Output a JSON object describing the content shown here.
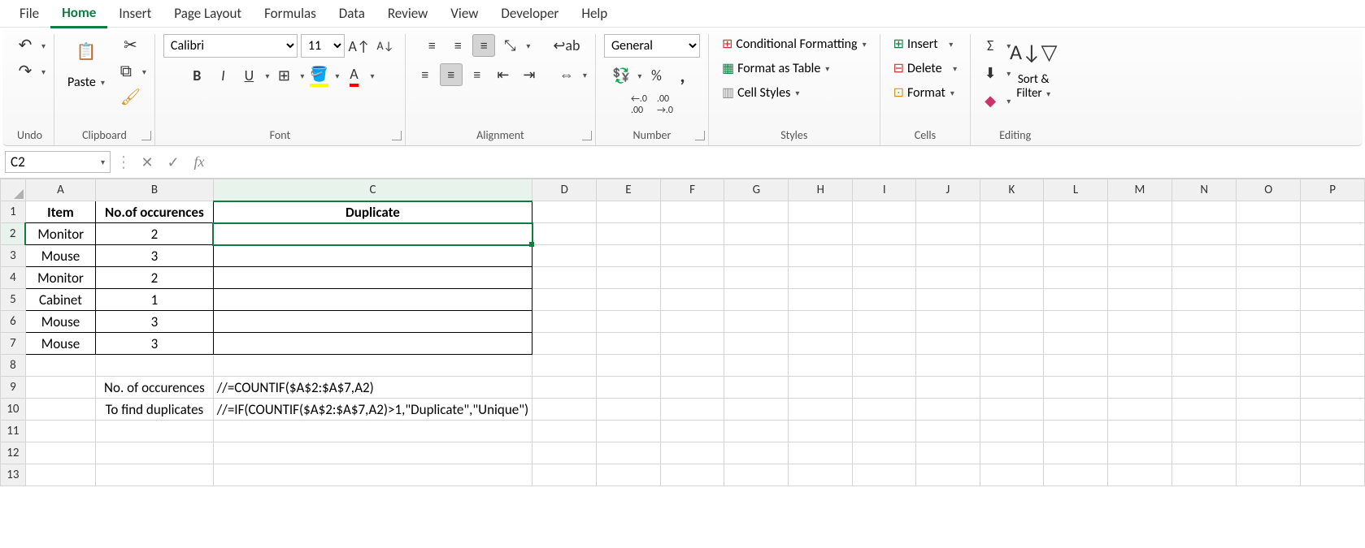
{
  "menubar": [
    "File",
    "Home",
    "Insert",
    "Page Layout",
    "Formulas",
    "Data",
    "Review",
    "View",
    "Developer",
    "Help"
  ],
  "active_tab": "Home",
  "ribbon": {
    "undo_label": "Undo",
    "clipboard_label": "Clipboard",
    "paste_label": "Paste",
    "font_label": "Font",
    "font_name": "Calibri",
    "font_size": "11",
    "alignment_label": "Alignment",
    "number_label": "Number",
    "number_format": "General",
    "styles_label": "Styles",
    "cond_fmt": "Conditional Formatting",
    "fmt_table": "Format as Table",
    "cell_styles": "Cell Styles",
    "cells_label": "Cells",
    "insert": "Insert",
    "delete": "Delete",
    "format": "Format",
    "editing_label": "Editing",
    "sort_filter1": "Sort &",
    "sort_filter2": "Filter"
  },
  "namebox": "C2",
  "formula": "",
  "columns": [
    "A",
    "B",
    "C",
    "D",
    "E",
    "F",
    "G",
    "H",
    "I",
    "J",
    "K",
    "L",
    "M",
    "N",
    "O",
    "P"
  ],
  "selected": {
    "col": "C",
    "row": 2
  },
  "chart_data": {
    "type": "table",
    "headers": {
      "A": "Item",
      "B": "No.of occurences",
      "C": "Duplicate"
    },
    "rows": [
      {
        "A": "Monitor",
        "B": "2",
        "C": ""
      },
      {
        "A": "Mouse",
        "B": "3",
        "C": ""
      },
      {
        "A": "Monitor",
        "B": "2",
        "C": ""
      },
      {
        "A": "Cabinet",
        "B": "1",
        "C": ""
      },
      {
        "A": "Mouse",
        "B": "3",
        "C": ""
      },
      {
        "A": "Mouse",
        "B": "3",
        "C": ""
      }
    ],
    "notes": [
      {
        "row": 9,
        "label": "No. of occurences",
        "formula": "//=COUNTIF($A$2:$A$7,A2)"
      },
      {
        "row": 10,
        "label": "To find duplicates",
        "formula": "//=IF(COUNTIF($A$2:$A$7,A2)>1,\"Duplicate\",\"Unique\")"
      }
    ]
  }
}
